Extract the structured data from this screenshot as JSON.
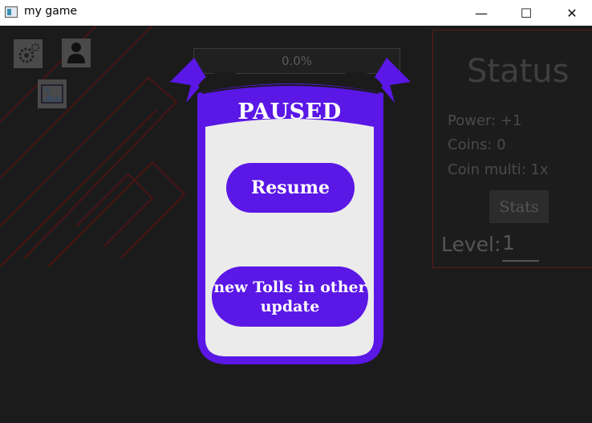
{
  "window": {
    "title": "my game",
    "controls": {
      "minimize": "—",
      "maximize": "☐",
      "close": "✕"
    }
  },
  "toolbar": {
    "icons": [
      "settings-icon",
      "profile-icon",
      "image-icon"
    ]
  },
  "progress": {
    "label": "0.0%",
    "fraction": 0.0
  },
  "status": {
    "title": "Status",
    "power": "Power: +1",
    "coins": "Coins: 0",
    "coin_multi": "Coin multi: 1x",
    "stats_button": "Stats",
    "level_label": "Level:",
    "level_value": "1"
  },
  "pause_menu": {
    "title": "PAUSED",
    "resume_label": "Resume",
    "tools_label": "new Tolls in other update"
  },
  "colors": {
    "accent": "#5a17e6",
    "panel_bg": "#ebebeb",
    "game_bg": "#1b1b1b",
    "red_lines": "#5a1515"
  }
}
